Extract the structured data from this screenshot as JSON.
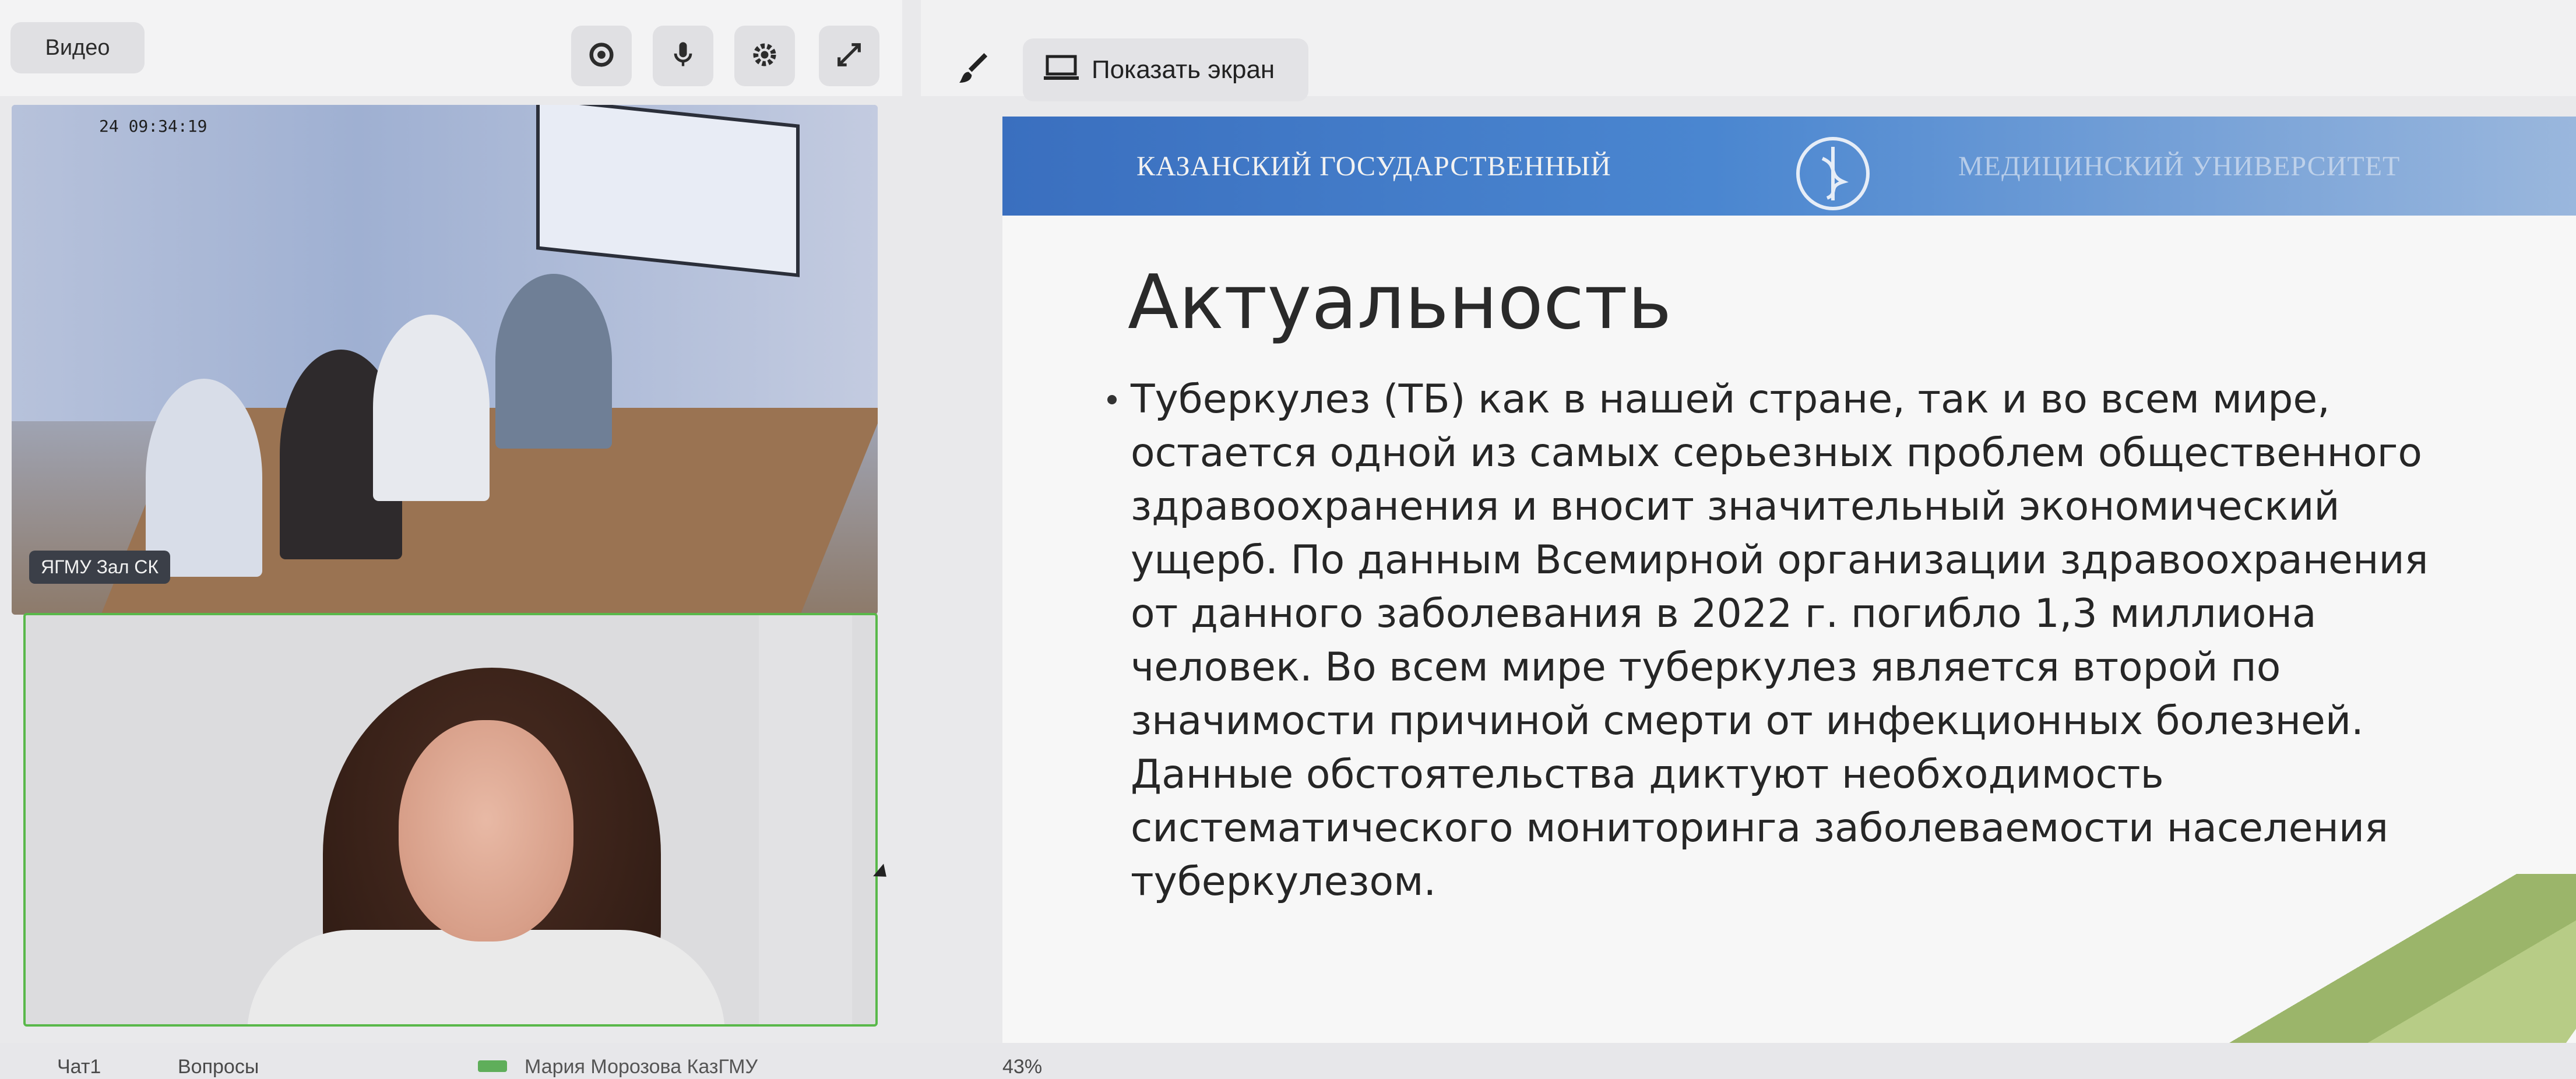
{
  "video_panel": {
    "tab_label": "Видео",
    "icons": [
      "camera-icon",
      "microphone-icon",
      "gear-icon",
      "fullscreen-icon"
    ]
  },
  "toolbar": {
    "brush_icon": "brush-icon",
    "share_screen_label": "Показать экран"
  },
  "tiles": {
    "room": {
      "timestamp": "24 09:34:19",
      "label": "ЯГМУ Зал СК"
    }
  },
  "slide": {
    "header_left": "КАЗАНСКИЙ ГОСУДАРСТВЕННЫЙ",
    "header_right": "МЕДИЦИНСКИЙ УНИВЕРСИТЕТ",
    "title": "Актуальность",
    "lines": [
      "Туберкулез (ТБ) как в нашей стране, так и во всем мире,",
      "остается одной из самых серьезных проблем общественного",
      "здравоохранения и вносит значительный экономический",
      "ущерб. По данным Всемирной организации здравоохранения",
      "от данного заболевания в 2022 г. погибло 1,3 миллиона",
      "человек. Во всем мире туберкулез является второй по",
      "значимости причиной смерти от инфекционных болезней.",
      "Данные обстоятельства диктуют необходимость",
      "систематического мониторинга заболеваемости населения",
      "туберкулезом."
    ]
  },
  "bottom_bar": {
    "chat": "Чат1",
    "questions": "Вопросы",
    "user": "Мария Морозова КазГМУ",
    "zoom": "43%"
  }
}
